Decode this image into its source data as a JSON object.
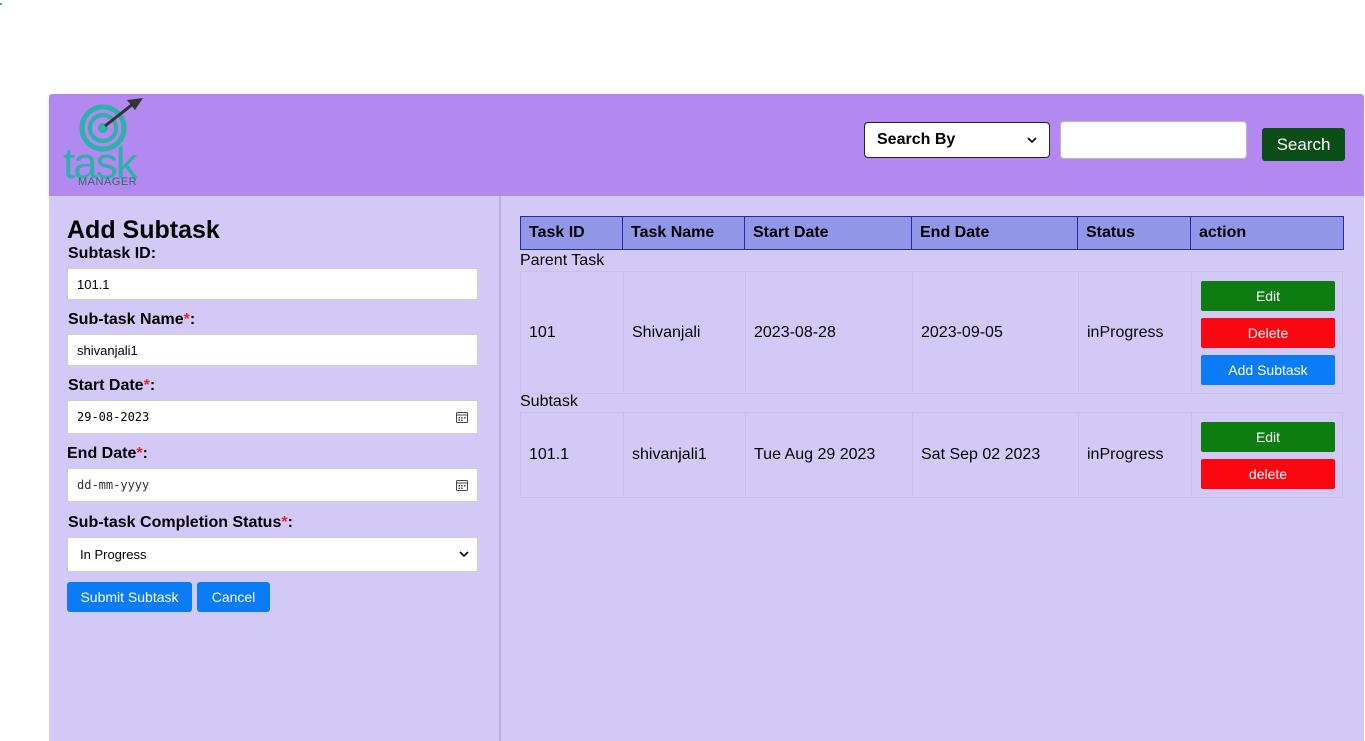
{
  "header": {
    "logo_text": "task",
    "logo_sub": "MANAGER",
    "search_select": "Search By",
    "search_value": "",
    "search_button": "Search"
  },
  "form": {
    "title": "Add Subtask",
    "subtask_id_label": "Subtask ID:",
    "subtask_id_value": "101.1",
    "name_label": "Sub-task Name",
    "name_value": "shivanjali1",
    "start_label": "Start Date",
    "start_value": "29-08-2023",
    "end_label": "End Date",
    "end_value": "dd-mm-yyyy",
    "status_label": "Sub-task Completion Status",
    "status_value": "In Progress",
    "required_mark": "*",
    "colon": ":",
    "submit_button": "Submit Subtask",
    "cancel_button": "Cancel"
  },
  "table": {
    "headers": [
      "Task ID",
      "Task Name",
      "Start Date",
      "End Date",
      "Status",
      "action"
    ],
    "parent_label": "Parent Task",
    "subtask_label": "Subtask",
    "parent_row": {
      "id": "101",
      "name": "Shivanjali",
      "start": "2023-08-28",
      "end": "2023-09-05",
      "status": "inProgress",
      "edit": "Edit",
      "delete": "Delete",
      "add_subtask": "Add Subtask"
    },
    "sub_row": {
      "id": "101.1",
      "name": "shivanjali1",
      "start": "Tue Aug 29 2023",
      "end": "Sat Sep 02 2023",
      "status": "inProgress",
      "edit": "Edit",
      "delete": "delete"
    }
  },
  "colors": {
    "header_bg": "#b388f0",
    "panel_bg": "#d3c9f7",
    "table_header_bg": "#9196e8",
    "search_button_bg": "#0b4d17",
    "edit_green": "#0d7d12",
    "delete_red": "#fb0711",
    "primary_blue": "#0a7cf5"
  },
  "icons": {
    "logo": "target-arrow-icon",
    "calendar": "calendar-icon",
    "dropdown": "chevron-down-icon"
  }
}
